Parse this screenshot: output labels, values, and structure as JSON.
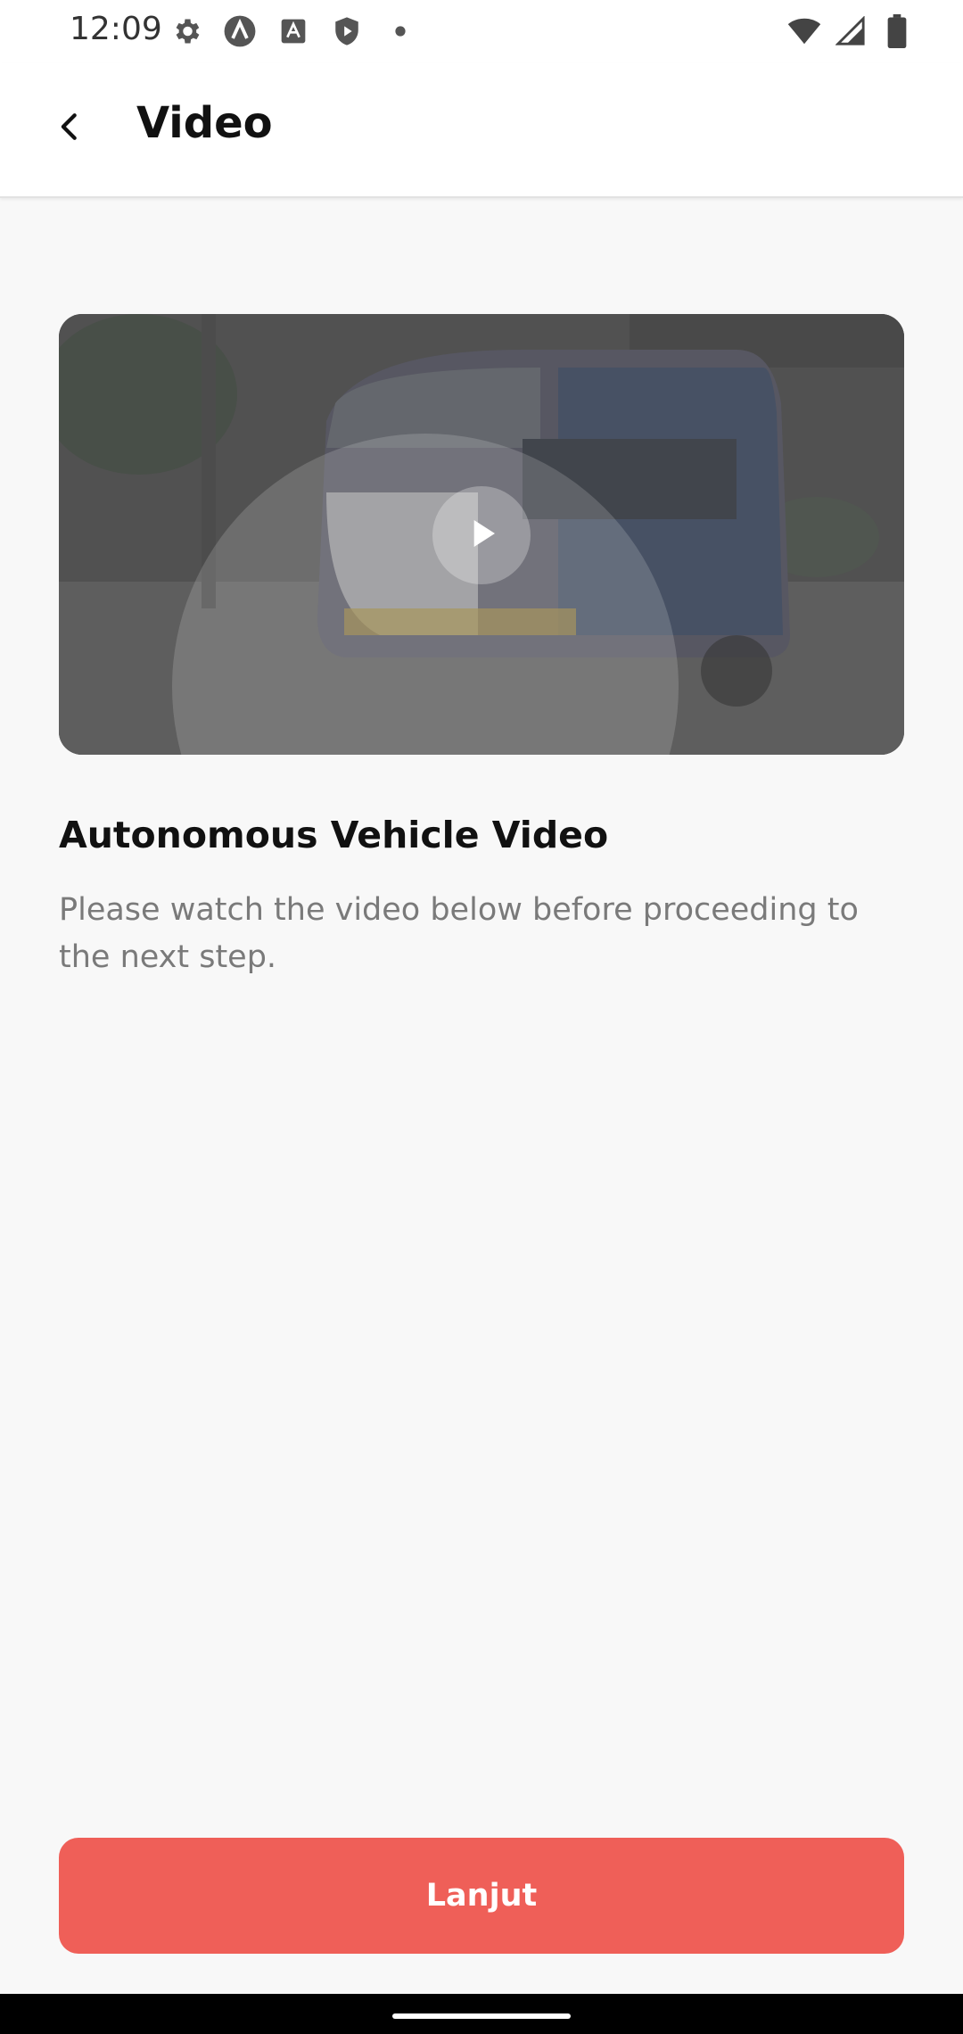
{
  "status_bar": {
    "time": "12:09",
    "left_icons": [
      "settings-icon",
      "app-a-icon",
      "font-icon",
      "shield-icon",
      "dot-icon"
    ],
    "right_icons": [
      "wifi-icon",
      "signal-icon",
      "battery-icon"
    ]
  },
  "app_bar": {
    "title": "Video",
    "back_icon": "chevron-left-icon"
  },
  "video": {
    "thumbnail_description": "autonomous vehicle",
    "play_icon": "play-icon"
  },
  "content": {
    "title": "Autonomous Vehicle Video",
    "description": "Please watch the video below before proceeding to the next step."
  },
  "footer": {
    "button_label": "Lanjut"
  },
  "colors": {
    "accent": "#ef5f58",
    "background": "#f8f8f8",
    "description_text": "#7a7a7a"
  }
}
